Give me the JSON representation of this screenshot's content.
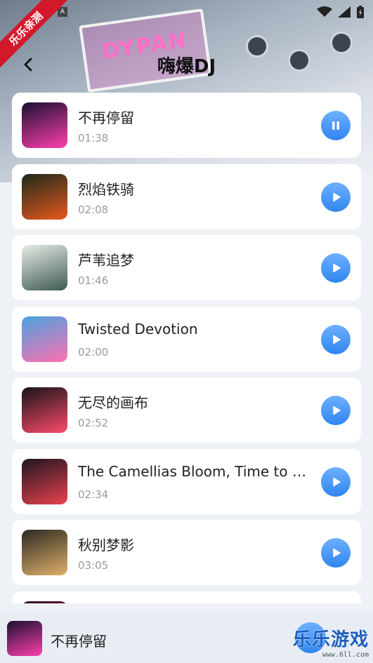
{
  "status_bar": {
    "watermark_ribbon": "乐乐亲测",
    "notification_badge": "A"
  },
  "header": {
    "back_icon": "chevron-left-icon",
    "title": "嗨爆DJ"
  },
  "hero": {
    "sign_text": "DYPAN"
  },
  "playlist": [
    {
      "title": "不再停留",
      "duration": "01:38",
      "state": "playing",
      "icon": "pause-icon",
      "cover_colors": [
        "#1a1030",
        "#ff3fae"
      ]
    },
    {
      "title": "烈焰铁骑",
      "duration": "02:08",
      "state": "paused",
      "icon": "play-icon",
      "cover_colors": [
        "#1d2a1a",
        "#e8581e"
      ]
    },
    {
      "title": "芦苇追梦",
      "duration": "01:46",
      "state": "paused",
      "icon": "play-icon",
      "cover_colors": [
        "#e8ece6",
        "#3d5a52"
      ]
    },
    {
      "title": "Twisted Devotion",
      "duration": "02:00",
      "state": "paused",
      "icon": "play-icon",
      "cover_colors": [
        "#4aa3e0",
        "#ff6fb0"
      ]
    },
    {
      "title": "无尽的画布",
      "duration": "02:52",
      "state": "paused",
      "icon": "play-icon",
      "cover_colors": [
        "#141418",
        "#ff4a6a"
      ]
    },
    {
      "title": "The Camellias Bloom, Time to Go Home",
      "duration": "02:34",
      "state": "paused",
      "icon": "play-icon",
      "cover_colors": [
        "#1f1420",
        "#e8434f"
      ]
    },
    {
      "title": "秋别梦影",
      "duration": "03:05",
      "state": "paused",
      "icon": "play-icon",
      "cover_colors": [
        "#2a2a22",
        "#e0b06a"
      ]
    },
    {
      "title": "",
      "duration": "",
      "state": "paused",
      "icon": "play-icon",
      "cover_colors": [
        "#301020",
        "#c02050"
      ]
    }
  ],
  "now_playing": {
    "title": "不再停留",
    "icon": "pause-icon"
  },
  "watermark": {
    "brand": "乐乐游戏",
    "url": "www.6ll.com"
  },
  "colors": {
    "accent": "#2f86f0",
    "card": "#ffffff",
    "background": "#eef1f5",
    "ribbon": "#d4182c"
  }
}
